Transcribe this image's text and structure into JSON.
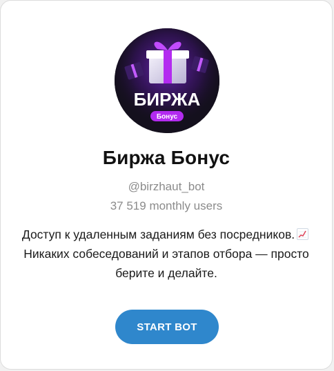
{
  "bot": {
    "name": "Биржа Бонус",
    "username": "@birzhaut_bot",
    "monthly_users": "37 519 monthly users",
    "description_part1": "Доступ к удаленным заданиям без посредников.",
    "description_icon": "chart-increasing-emoji",
    "description_part2": " Никаких собеседований и этапов отбора — просто берите и делайте."
  },
  "avatar": {
    "logo_text": "БИРЖА",
    "badge_text": "Бонус",
    "accent_color": "#b32bf0",
    "background_color": "#14101d"
  },
  "button": {
    "label": "START BOT",
    "color": "#2f87cc"
  }
}
